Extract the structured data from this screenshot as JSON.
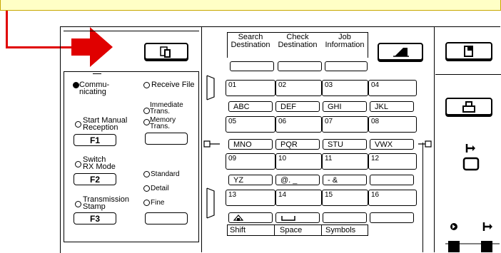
{
  "left_panel": {
    "status_items": [
      {
        "label": "Commu-\nnicating",
        "led": "on"
      },
      {
        "label": "Receive File",
        "led": "off"
      }
    ],
    "immediate_label": "Immediate\nTrans.",
    "memory_label": "Memory\nTrans.",
    "start_manual_label": "Start Manual\nReception",
    "f1_label": "F1",
    "switch_rx_label": "Switch\nRX Mode",
    "f2_label": "F2",
    "standard_label": "Standard",
    "detail_label": "Detail",
    "fine_label": "Fine",
    "transmission_stamp_label": "Transmission\nStamp",
    "f3_label": "F3"
  },
  "top_buttons": {
    "search_destination": "Search\nDestination",
    "check_destination": "Check\nDestination",
    "job_information": "Job\nInformation"
  },
  "one_touch": {
    "numbers": [
      "01",
      "02",
      "03",
      "04",
      "05",
      "06",
      "07",
      "08",
      "09",
      "10",
      "11",
      "12",
      "13",
      "14",
      "15",
      "16"
    ],
    "letter_rows": [
      [
        "ABC",
        "DEF",
        "GHI",
        "JKL"
      ],
      [
        "MNO",
        "PQR",
        "STU",
        "VWX"
      ],
      [
        "YZ",
        "@. _",
        "- &",
        ""
      ]
    ],
    "bottom_labels": [
      "Shift",
      "Space",
      "Symbols"
    ]
  },
  "colors": {
    "callout_bg": "#ffffc6",
    "arrow_red": "#e00000"
  }
}
